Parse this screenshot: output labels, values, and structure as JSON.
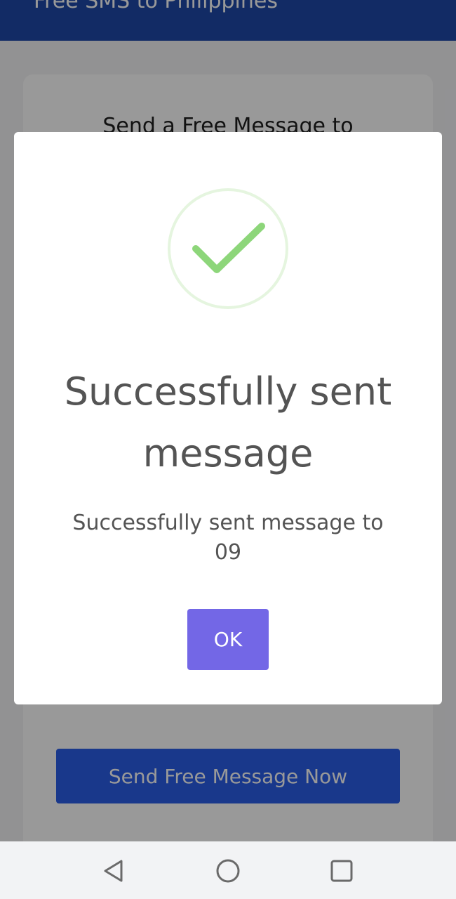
{
  "app": {
    "header_title": "Free SMS to Philippines",
    "card_heading": "Send a Free Message to",
    "send_button_label": "Send Free Message Now"
  },
  "dialog": {
    "icon": "check-circle-icon",
    "title": "Successfully sent message",
    "message": "Successfully sent message to 09",
    "ok_label": "OK"
  },
  "nav_bar": {
    "buttons": [
      "back-icon",
      "home-icon",
      "recents-icon"
    ]
  },
  "colors": {
    "header": "#1f49a8",
    "send_button": "#2a5ee8",
    "ok_button": "#7367e6",
    "success_check": "#8dd67a",
    "success_ring": "#e5f5df"
  }
}
